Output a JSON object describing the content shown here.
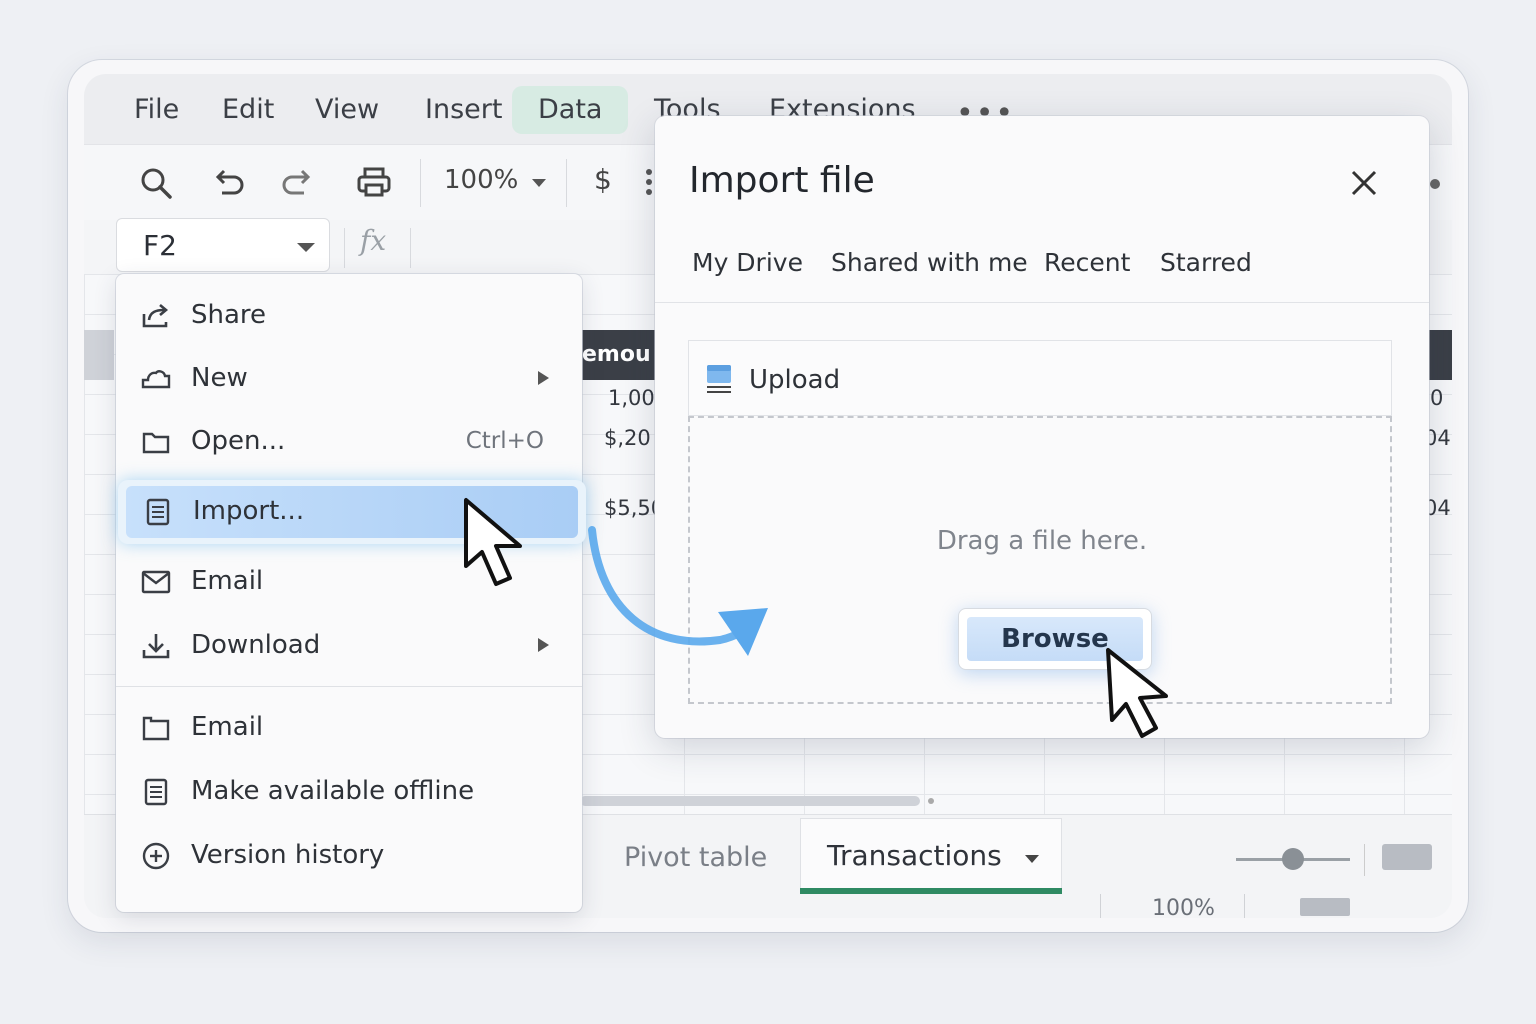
{
  "menubar": {
    "items": [
      {
        "label": "File"
      },
      {
        "label": "Edit"
      },
      {
        "label": "View"
      },
      {
        "label": "Insert"
      },
      {
        "label": "Data",
        "active": true
      },
      {
        "label": "Tools"
      },
      {
        "label": "Extensions"
      }
    ],
    "more_icon": "more-horizontal-icon"
  },
  "toolbar": {
    "icons": [
      "search-icon",
      "undo-icon",
      "redo-icon",
      "print-icon"
    ],
    "zoom": "100%",
    "currency": "$"
  },
  "formula_bar": {
    "cell_ref": "F2",
    "fx_label": "fx"
  },
  "grid": {
    "header_fragment": "emou",
    "cells": [
      "1,00",
      "$,20",
      "$5,50",
      "0",
      "04",
      "04"
    ]
  },
  "file_menu": {
    "items": [
      {
        "label": "Share",
        "icon": "share-icon"
      },
      {
        "label": "New",
        "icon": "cloud-icon",
        "submenu": true
      },
      {
        "label": "Open...",
        "icon": "folder-icon",
        "shortcut": "Ctrl+O"
      },
      {
        "label": "Import...",
        "icon": "document-icon",
        "highlighted": true
      },
      {
        "label": "Email",
        "icon": "mail-icon"
      },
      {
        "label": "Download",
        "icon": "download-icon",
        "submenu": true
      },
      {
        "label": "Email",
        "icon": "folder-icon"
      },
      {
        "label": "Make available offline",
        "icon": "document-icon"
      },
      {
        "label": "Version history",
        "icon": "plus-circle-icon"
      }
    ]
  },
  "import_dialog": {
    "title": "Import file",
    "tabs": [
      "My Drive",
      "Shared with me",
      "Recent",
      "Starred"
    ],
    "upload_label": "Upload",
    "drop_text": "Drag a file here.",
    "browse_label": "Browse"
  },
  "sheets": {
    "tabs": [
      "Pivot table",
      "Transactions"
    ],
    "active": "Transactions"
  },
  "status": {
    "zoom": "100%"
  },
  "colors": {
    "accent_green": "#2f8a63",
    "highlight_blue": "#a9cdf5",
    "arrow_blue": "#5aa8ec"
  }
}
